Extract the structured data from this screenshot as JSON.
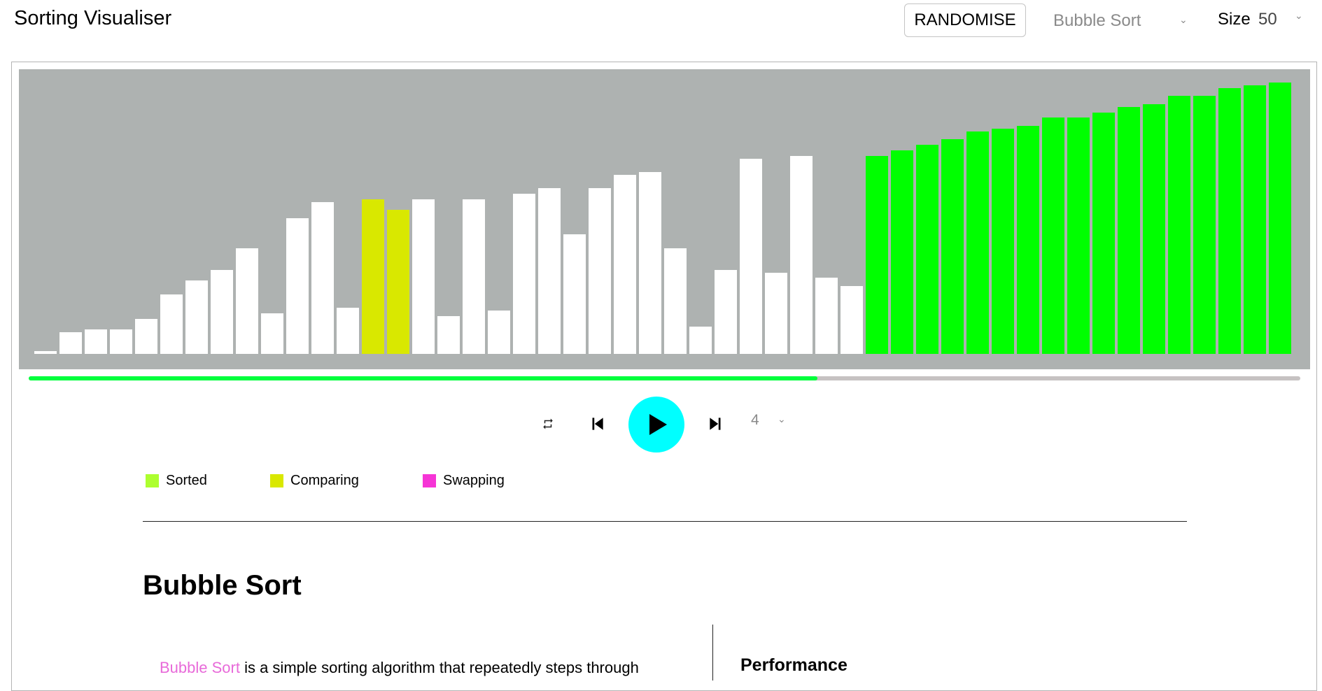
{
  "header": {
    "title": "Sorting Visualiser",
    "randomise_label": "RANDOMISE",
    "algorithm": "Bubble Sort",
    "size_label": "Size",
    "size_value": "50"
  },
  "colors": {
    "chart_bg": "#aeb2b1",
    "unsorted": "#ffffff",
    "sorted": "#00ff00",
    "comparing": "#d9e800",
    "progress": "#00ff3c",
    "play_button": "#00ffff",
    "legend_sorted": "#adff2f",
    "legend_comparing": "#d9e800",
    "legend_swapping": "#f634d6",
    "link": "#e86ad9"
  },
  "playback": {
    "progress_fraction": 0.62,
    "speed": "4",
    "repeat_icon": "repeat-icon",
    "prev_icon": "skip-previous-icon",
    "play_icon": "play-icon",
    "next_icon": "skip-next-icon"
  },
  "legend": [
    {
      "label": "Sorted",
      "color": "#adff2f"
    },
    {
      "label": "Comparing",
      "color": "#d9e800"
    },
    {
      "label": "Swapping",
      "color": "#f634d6"
    }
  ],
  "info": {
    "heading": "Bubble Sort",
    "description_link": "Bubble Sort",
    "description_rest": " is a simple sorting algorithm that repeatedly steps through",
    "performance_heading": "Performance"
  },
  "chart_data": {
    "type": "bar",
    "title": "",
    "xlabel": "",
    "ylabel": "",
    "ylim": [
      0,
      100
    ],
    "values": [
      1,
      8,
      9,
      9,
      13,
      22,
      27,
      31,
      39,
      15,
      50,
      56,
      17,
      57,
      53,
      57,
      14,
      57,
      16,
      59,
      61,
      44,
      61,
      66,
      67,
      39,
      10,
      31,
      72,
      30,
      73,
      28,
      25,
      73,
      75,
      77,
      79,
      82,
      83,
      84,
      87,
      87,
      89,
      91,
      92,
      95,
      95,
      98,
      99,
      100
    ],
    "states": [
      "u",
      "u",
      "u",
      "u",
      "u",
      "u",
      "u",
      "u",
      "u",
      "u",
      "u",
      "u",
      "u",
      "c",
      "c",
      "u",
      "u",
      "u",
      "u",
      "u",
      "u",
      "u",
      "u",
      "u",
      "u",
      "u",
      "u",
      "u",
      "u",
      "u",
      "u",
      "u",
      "u",
      "s",
      "s",
      "s",
      "s",
      "s",
      "s",
      "s",
      "s",
      "s",
      "s",
      "s",
      "s",
      "s",
      "s",
      "s",
      "s",
      "s"
    ],
    "state_legend": {
      "u": "unsorted",
      "c": "comparing",
      "s": "sorted"
    }
  }
}
